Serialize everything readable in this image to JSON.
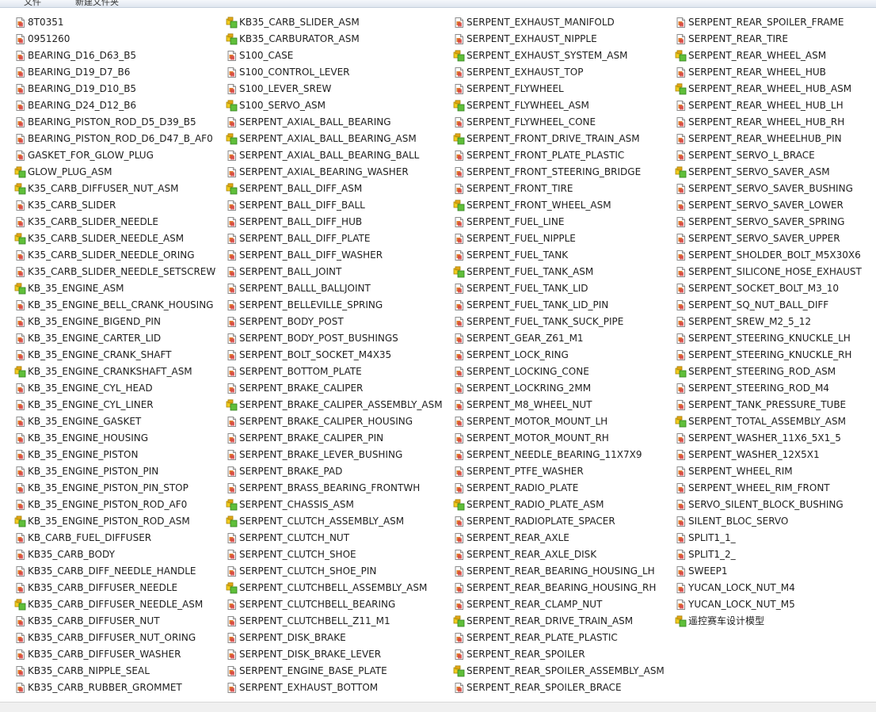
{
  "toolbar": {
    "items": [
      "文件",
      "新建文件夹"
    ]
  },
  "icons": {
    "part": "part-file-icon",
    "assembly": "assembly-file-icon"
  },
  "columns": [
    [
      {
        "name": "8T0351",
        "type": "part"
      },
      {
        "name": "0951260",
        "type": "part"
      },
      {
        "name": "BEARING_D16_D63_B5",
        "type": "part"
      },
      {
        "name": "BEARING_D19_D7_B6",
        "type": "part"
      },
      {
        "name": "BEARING_D19_D10_B5",
        "type": "part"
      },
      {
        "name": "BEARING_D24_D12_B6",
        "type": "part"
      },
      {
        "name": "BEARING_PISTON_ROD_D5_D39_B5",
        "type": "part"
      },
      {
        "name": "BEARING_PISTON_ROD_D6_D47_B_AF0",
        "type": "part"
      },
      {
        "name": "GASKET_FOR_GLOW_PLUG",
        "type": "part"
      },
      {
        "name": "GLOW_PLUG_ASM",
        "type": "assembly"
      },
      {
        "name": "K35_CARB_DIFFUSER_NUT_ASM",
        "type": "assembly"
      },
      {
        "name": "K35_CARB_SLIDER",
        "type": "part"
      },
      {
        "name": "K35_CARB_SLIDER_NEEDLE",
        "type": "part"
      },
      {
        "name": "K35_CARB_SLIDER_NEEDLE_ASM",
        "type": "assembly"
      },
      {
        "name": "K35_CARB_SLIDER_NEEDLE_ORING",
        "type": "part"
      },
      {
        "name": "K35_CARB_SLIDER_NEEDLE_SETSCREW",
        "type": "part"
      },
      {
        "name": "KB_35_ENGINE_ASM",
        "type": "assembly"
      },
      {
        "name": "KB_35_ENGINE_BELL_CRANK_HOUSING",
        "type": "part"
      },
      {
        "name": "KB_35_ENGINE_BIGEND_PIN",
        "type": "part"
      },
      {
        "name": "KB_35_ENGINE_CARTER_LID",
        "type": "part"
      },
      {
        "name": "KB_35_ENGINE_CRANK_SHAFT",
        "type": "part"
      },
      {
        "name": "KB_35_ENGINE_CRANKSHAFT_ASM",
        "type": "assembly"
      },
      {
        "name": "KB_35_ENGINE_CYL_HEAD",
        "type": "part"
      },
      {
        "name": "KB_35_ENGINE_CYL_LINER",
        "type": "part"
      },
      {
        "name": "KB_35_ENGINE_GASKET",
        "type": "part"
      },
      {
        "name": "KB_35_ENGINE_HOUSING",
        "type": "part"
      },
      {
        "name": "KB_35_ENGINE_PISTON",
        "type": "part"
      },
      {
        "name": "KB_35_ENGINE_PISTON_PIN",
        "type": "part"
      },
      {
        "name": "KB_35_ENGINE_PISTON_PIN_STOP",
        "type": "part"
      },
      {
        "name": "KB_35_ENGINE_PISTON_ROD_AF0",
        "type": "part"
      },
      {
        "name": "KB_35_ENGINE_PISTON_ROD_ASM",
        "type": "assembly"
      },
      {
        "name": "KB_CARB_FUEL_DIFFUSER",
        "type": "part"
      },
      {
        "name": "KB35_CARB_BODY",
        "type": "part"
      },
      {
        "name": "KB35_CARB_DIFF_NEEDLE_HANDLE",
        "type": "part"
      },
      {
        "name": "KB35_CARB_DIFFUSER_NEEDLE",
        "type": "part"
      },
      {
        "name": "KB35_CARB_DIFFUSER_NEEDLE_ASM",
        "type": "assembly"
      },
      {
        "name": "KB35_CARB_DIFFUSER_NUT",
        "type": "part"
      },
      {
        "name": "KB35_CARB_DIFFUSER_NUT_ORING",
        "type": "part"
      },
      {
        "name": "KB35_CARB_DIFFUSER_WASHER",
        "type": "part"
      },
      {
        "name": "KB35_CARB_NIPPLE_SEAL",
        "type": "part"
      },
      {
        "name": "KB35_CARB_RUBBER_GROMMET",
        "type": "part"
      }
    ],
    [
      {
        "name": "KB35_CARB_SLIDER_ASM",
        "type": "assembly"
      },
      {
        "name": "KB35_CARBURATOR_ASM",
        "type": "assembly"
      },
      {
        "name": "S100_CASE",
        "type": "part"
      },
      {
        "name": "S100_CONTROL_LEVER",
        "type": "part"
      },
      {
        "name": "S100_LEVER_SREW",
        "type": "part"
      },
      {
        "name": "S100_SERVO_ASM",
        "type": "assembly"
      },
      {
        "name": "SERPENT_AXIAL_BALL_BEARING",
        "type": "part"
      },
      {
        "name": "SERPENT_AXIAL_BALL_BEARING_ASM",
        "type": "assembly"
      },
      {
        "name": "SERPENT_AXIAL_BALL_BEARING_BALL",
        "type": "part"
      },
      {
        "name": "SERPENT_AXIAL_BEARING_WASHER",
        "type": "part"
      },
      {
        "name": "SERPENT_BALL_DIFF_ASM",
        "type": "assembly"
      },
      {
        "name": "SERPENT_BALL_DIFF_BALL",
        "type": "part"
      },
      {
        "name": "SERPENT_BALL_DIFF_HUB",
        "type": "part"
      },
      {
        "name": "SERPENT_BALL_DIFF_PLATE",
        "type": "part"
      },
      {
        "name": "SERPENT_BALL_DIFF_WASHER",
        "type": "part"
      },
      {
        "name": "SERPENT_BALL_JOINT",
        "type": "part"
      },
      {
        "name": "SERPENT_BALLL_BALLJOINT",
        "type": "part"
      },
      {
        "name": "SERPENT_BELLEVILLE_SPRING",
        "type": "part"
      },
      {
        "name": "SERPENT_BODY_POST",
        "type": "part"
      },
      {
        "name": "SERPENT_BODY_POST_BUSHINGS",
        "type": "part"
      },
      {
        "name": "SERPENT_BOLT_SOCKET_M4X35",
        "type": "part"
      },
      {
        "name": "SERPENT_BOTTOM_PLATE",
        "type": "part"
      },
      {
        "name": "SERPENT_BRAKE_CALIPER",
        "type": "part"
      },
      {
        "name": "SERPENT_BRAKE_CALIPER_ASSEMBLY_ASM",
        "type": "assembly"
      },
      {
        "name": "SERPENT_BRAKE_CALIPER_HOUSING",
        "type": "part"
      },
      {
        "name": "SERPENT_BRAKE_CALIPER_PIN",
        "type": "part"
      },
      {
        "name": "SERPENT_BRAKE_LEVER_BUSHING",
        "type": "part"
      },
      {
        "name": "SERPENT_BRAKE_PAD",
        "type": "part"
      },
      {
        "name": "SERPENT_BRASS_BEARING_FRONTWH",
        "type": "part"
      },
      {
        "name": "SERPENT_CHASSIS_ASM",
        "type": "assembly"
      },
      {
        "name": "SERPENT_CLUTCH_ASSEMBLY_ASM",
        "type": "assembly"
      },
      {
        "name": "SERPENT_CLUTCH_NUT",
        "type": "part"
      },
      {
        "name": "SERPENT_CLUTCH_SHOE",
        "type": "part"
      },
      {
        "name": "SERPENT_CLUTCH_SHOE_PIN",
        "type": "part"
      },
      {
        "name": "SERPENT_CLUTCHBELL_ASSEMBLY_ASM",
        "type": "assembly"
      },
      {
        "name": "SERPENT_CLUTCHBELL_BEARING",
        "type": "part"
      },
      {
        "name": "SERPENT_CLUTCHBELL_Z11_M1",
        "type": "part"
      },
      {
        "name": "SERPENT_DISK_BRAKE",
        "type": "part"
      },
      {
        "name": "SERPENT_DISK_BRAKE_LEVER",
        "type": "part"
      },
      {
        "name": "SERPENT_ENGINE_BASE_PLATE",
        "type": "part"
      },
      {
        "name": "SERPENT_EXHAUST_BOTTOM",
        "type": "part"
      }
    ],
    [
      {
        "name": "SERPENT_EXHAUST_MANIFOLD",
        "type": "part"
      },
      {
        "name": "SERPENT_EXHAUST_NIPPLE",
        "type": "part"
      },
      {
        "name": "SERPENT_EXHAUST_SYSTEM_ASM",
        "type": "assembly"
      },
      {
        "name": "SERPENT_EXHAUST_TOP",
        "type": "part"
      },
      {
        "name": "SERPENT_FLYWHEEL",
        "type": "part"
      },
      {
        "name": "SERPENT_FLYWHEEL_ASM",
        "type": "assembly"
      },
      {
        "name": "SERPENT_FLYWHEEL_CONE",
        "type": "part"
      },
      {
        "name": "SERPENT_FRONT_DRIVE_TRAIN_ASM",
        "type": "assembly"
      },
      {
        "name": "SERPENT_FRONT_PLATE_PLASTIC",
        "type": "part"
      },
      {
        "name": "SERPENT_FRONT_STEERING_BRIDGE",
        "type": "part"
      },
      {
        "name": "SERPENT_FRONT_TIRE",
        "type": "part"
      },
      {
        "name": "SERPENT_FRONT_WHEEL_ASM",
        "type": "assembly"
      },
      {
        "name": "SERPENT_FUEL_LINE",
        "type": "part"
      },
      {
        "name": "SERPENT_FUEL_NIPPLE",
        "type": "part"
      },
      {
        "name": "SERPENT_FUEL_TANK",
        "type": "part"
      },
      {
        "name": "SERPENT_FUEL_TANK_ASM",
        "type": "assembly"
      },
      {
        "name": "SERPENT_FUEL_TANK_LID",
        "type": "part"
      },
      {
        "name": "SERPENT_FUEL_TANK_LID_PIN",
        "type": "part"
      },
      {
        "name": "SERPENT_FUEL_TANK_SUCK_PIPE",
        "type": "part"
      },
      {
        "name": "SERPENT_GEAR_Z61_M1",
        "type": "part"
      },
      {
        "name": "SERPENT_LOCK_RING",
        "type": "part"
      },
      {
        "name": "SERPENT_LOCKING_CONE",
        "type": "part"
      },
      {
        "name": "SERPENT_LOCKRING_2MM",
        "type": "part"
      },
      {
        "name": "SERPENT_M8_WHEEL_NUT",
        "type": "part"
      },
      {
        "name": "SERPENT_MOTOR_MOUNT_LH",
        "type": "part"
      },
      {
        "name": "SERPENT_MOTOR_MOUNT_RH",
        "type": "part"
      },
      {
        "name": "SERPENT_NEEDLE_BEARING_11X7X9",
        "type": "part"
      },
      {
        "name": "SERPENT_PTFE_WASHER",
        "type": "part"
      },
      {
        "name": "SERPENT_RADIO_PLATE",
        "type": "part"
      },
      {
        "name": "SERPENT_RADIO_PLATE_ASM",
        "type": "assembly"
      },
      {
        "name": "SERPENT_RADIOPLATE_SPACER",
        "type": "part"
      },
      {
        "name": "SERPENT_REAR_AXLE",
        "type": "part"
      },
      {
        "name": "SERPENT_REAR_AXLE_DISK",
        "type": "part"
      },
      {
        "name": "SERPENT_REAR_BEARING_HOUSING_LH",
        "type": "part"
      },
      {
        "name": "SERPENT_REAR_BEARING_HOUSING_RH",
        "type": "part"
      },
      {
        "name": "SERPENT_REAR_CLAMP_NUT",
        "type": "part"
      },
      {
        "name": "SERPENT_REAR_DRIVE_TRAIN_ASM",
        "type": "assembly"
      },
      {
        "name": "SERPENT_REAR_PLATE_PLASTIC",
        "type": "part"
      },
      {
        "name": "SERPENT_REAR_SPOILER",
        "type": "part"
      },
      {
        "name": "SERPENT_REAR_SPOILER_ASSEMBLY_ASM",
        "type": "assembly"
      },
      {
        "name": "SERPENT_REAR_SPOILER_BRACE",
        "type": "part"
      }
    ],
    [
      {
        "name": "SERPENT_REAR_SPOILER_FRAME",
        "type": "part"
      },
      {
        "name": "SERPENT_REAR_TIRE",
        "type": "part"
      },
      {
        "name": "SERPENT_REAR_WHEEL_ASM",
        "type": "assembly"
      },
      {
        "name": "SERPENT_REAR_WHEEL_HUB",
        "type": "part"
      },
      {
        "name": "SERPENT_REAR_WHEEL_HUB_ASM",
        "type": "assembly"
      },
      {
        "name": "SERPENT_REAR_WHEEL_HUB_LH",
        "type": "part"
      },
      {
        "name": "SERPENT_REAR_WHEEL_HUB_RH",
        "type": "part"
      },
      {
        "name": "SERPENT_REAR_WHEELHUB_PIN",
        "type": "part"
      },
      {
        "name": "SERPENT_SERVO_L_BRACE",
        "type": "part"
      },
      {
        "name": "SERPENT_SERVO_SAVER_ASM",
        "type": "assembly"
      },
      {
        "name": "SERPENT_SERVO_SAVER_BUSHING",
        "type": "part"
      },
      {
        "name": "SERPENT_SERVO_SAVER_LOWER",
        "type": "part"
      },
      {
        "name": "SERPENT_SERVO_SAVER_SPRING",
        "type": "part"
      },
      {
        "name": "SERPENT_SERVO_SAVER_UPPER",
        "type": "part"
      },
      {
        "name": "SERPENT_SHOLDER_BOLT_M5X30X6",
        "type": "part"
      },
      {
        "name": "SERPENT_SILICONE_HOSE_EXHAUST",
        "type": "part"
      },
      {
        "name": "SERPENT_SOCKET_BOLT_M3_10",
        "type": "part"
      },
      {
        "name": "SERPENT_SQ_NUT_BALL_DIFF",
        "type": "part"
      },
      {
        "name": "SERPENT_SREW_M2_5_12",
        "type": "part"
      },
      {
        "name": "SERPENT_STEERING_KNUCKLE_LH",
        "type": "part"
      },
      {
        "name": "SERPENT_STEERING_KNUCKLE_RH",
        "type": "part"
      },
      {
        "name": "SERPENT_STEERING_ROD_ASM",
        "type": "assembly"
      },
      {
        "name": "SERPENT_STEERING_ROD_M4",
        "type": "part"
      },
      {
        "name": "SERPENT_TANK_PRESSURE_TUBE",
        "type": "part"
      },
      {
        "name": "SERPENT_TOTAL_ASSEMBLY_ASM",
        "type": "assembly"
      },
      {
        "name": "SERPENT_WASHER_11X6_5X1_5",
        "type": "part"
      },
      {
        "name": "SERPENT_WASHER_12X5X1",
        "type": "part"
      },
      {
        "name": "SERPENT_WHEEL_RIM",
        "type": "part"
      },
      {
        "name": "SERPENT_WHEEL_RIM_FRONT",
        "type": "part"
      },
      {
        "name": "SERVO_SILENT_BLOCK_BUSHING",
        "type": "part"
      },
      {
        "name": "SILENT_BLOC_SERVO",
        "type": "part"
      },
      {
        "name": "SPLIT1_1_",
        "type": "part"
      },
      {
        "name": "SPLIT1_2_",
        "type": "part"
      },
      {
        "name": "SWEEP1",
        "type": "part"
      },
      {
        "name": "YUCAN_LOCK_NUT_M4",
        "type": "part"
      },
      {
        "name": "YUCAN_LOCK_NUT_M5",
        "type": "part"
      },
      {
        "name": "遥控赛车设计模型",
        "type": "assembly"
      }
    ]
  ]
}
